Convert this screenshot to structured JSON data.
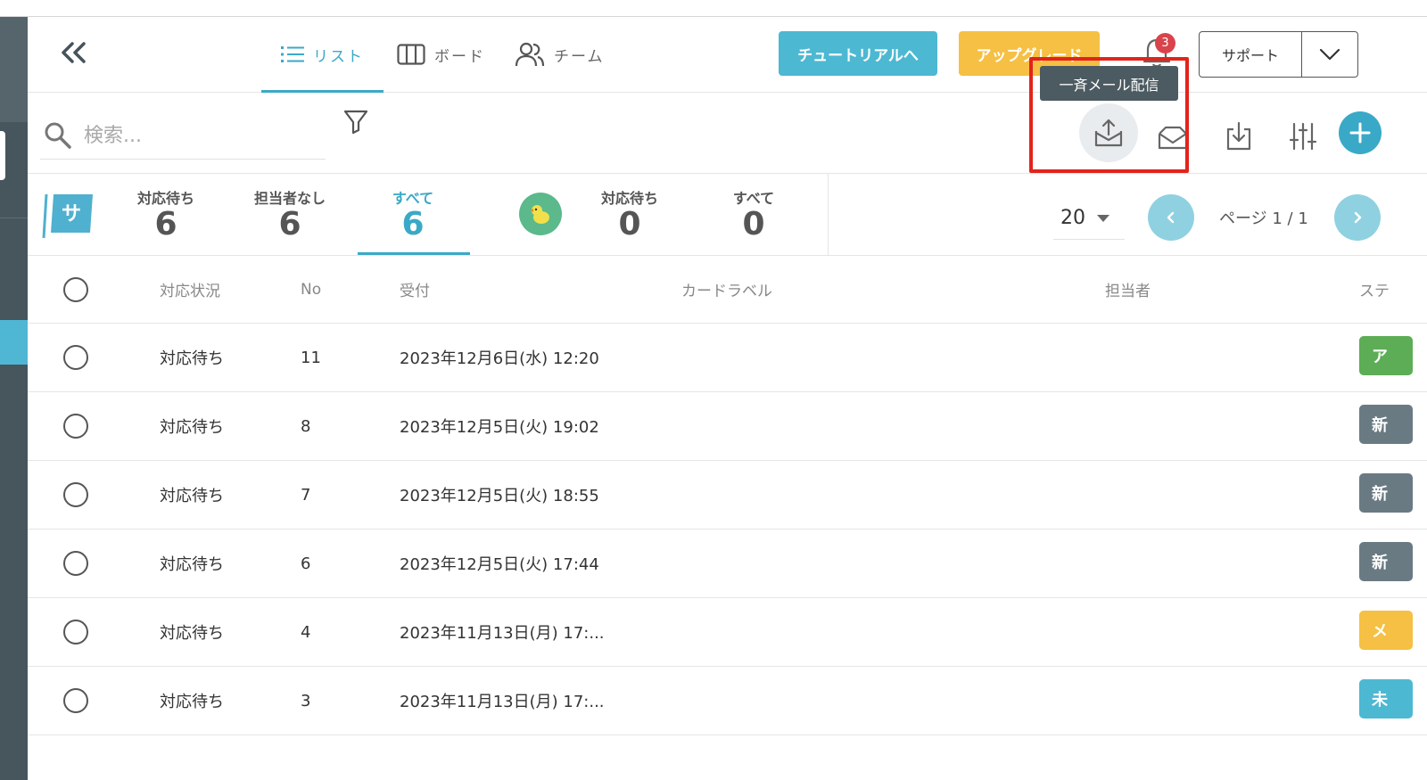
{
  "header": {
    "tabs": [
      {
        "label": "リスト",
        "icon": "list-icon",
        "active": true
      },
      {
        "label": "ボード",
        "icon": "board-icon",
        "active": false
      },
      {
        "label": "チーム",
        "icon": "team-icon",
        "active": false
      }
    ],
    "tutorial_label": "チュートリアルへ",
    "upgrade_label": "アップグレード",
    "notification_count": "3",
    "support_label": "サポート"
  },
  "toolbar": {
    "search_placeholder": "検索...",
    "tooltip": "一斉メール配信"
  },
  "status_row": {
    "flag_label": "サ",
    "group1": [
      {
        "label": "対応待ち",
        "count": "6"
      },
      {
        "label": "担当者なし",
        "count": "6"
      },
      {
        "label": "すべて",
        "count": "6"
      }
    ],
    "group2": [
      {
        "label": "対応待ち",
        "count": "0"
      },
      {
        "label": "すべて",
        "count": "0"
      }
    ],
    "per_page": "20",
    "page_info": "ページ 1 / 1"
  },
  "table": {
    "columns": [
      "対応状況",
      "No",
      "受付",
      "カードラベル",
      "担当者",
      "ステ"
    ],
    "rows": [
      {
        "status": "対応待ち",
        "no": "11",
        "received": "2023年12月6日(水) 12:20",
        "tag": "ア",
        "tag_color": "#5cad55"
      },
      {
        "status": "対応待ち",
        "no": "8",
        "received": "2023年12月5日(火) 19:02",
        "tag": "新",
        "tag_color": "#6a7a83"
      },
      {
        "status": "対応待ち",
        "no": "7",
        "received": "2023年12月5日(火) 18:55",
        "tag": "新",
        "tag_color": "#6a7a83"
      },
      {
        "status": "対応待ち",
        "no": "6",
        "received": "2023年12月5日(火) 17:44",
        "tag": "新",
        "tag_color": "#6a7a83"
      },
      {
        "status": "対応待ち",
        "no": "4",
        "received": "2023年11月13日(月) 17:...",
        "tag": "メ",
        "tag_color": "#f5c043"
      },
      {
        "status": "対応待ち",
        "no": "3",
        "received": "2023年11月13日(月) 17:...",
        "tag": "未",
        "tag_color": "#4db8d2"
      }
    ]
  },
  "colors": {
    "accent": "#3aa9c7",
    "sidebar": "#47555c",
    "highlight": "#e3231c"
  }
}
